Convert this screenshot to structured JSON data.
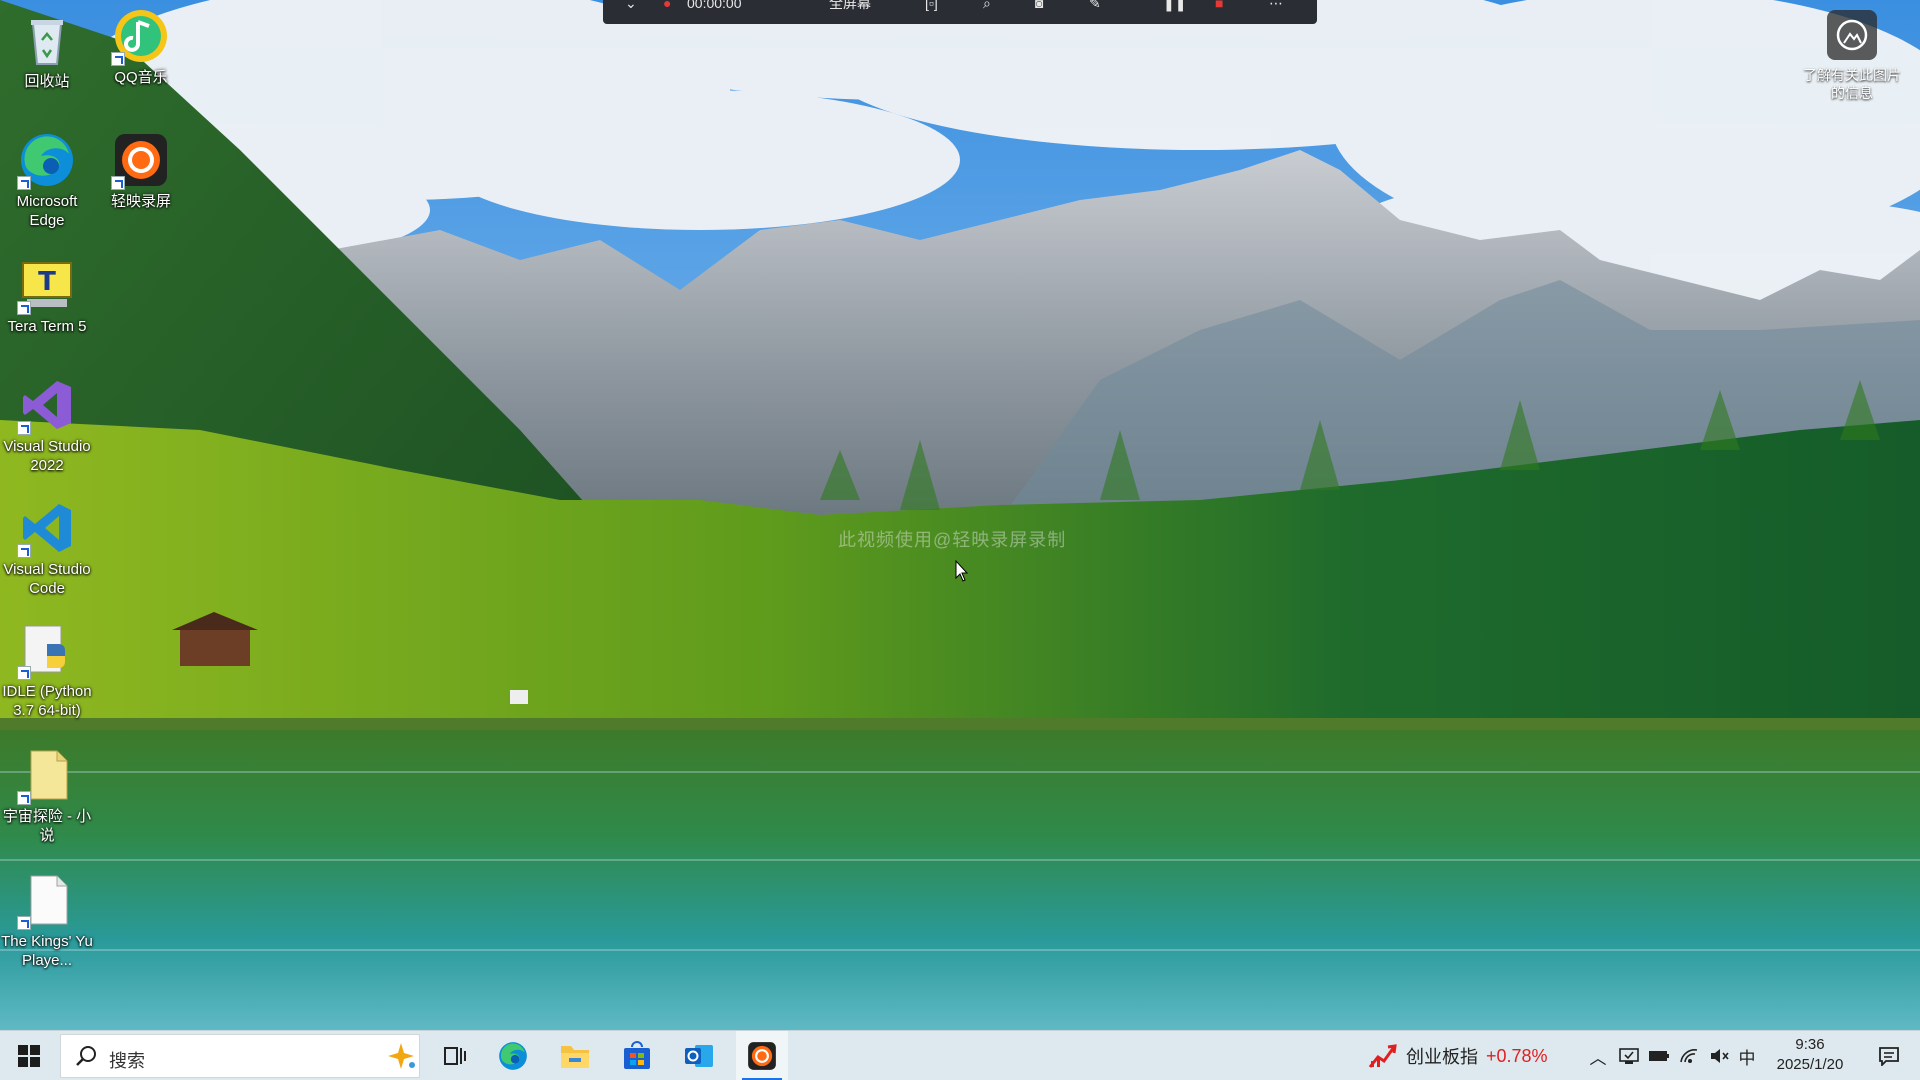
{
  "desktop_icons": [
    {
      "id": "recycle-bin",
      "label": "回收站"
    },
    {
      "id": "qq-music",
      "label": "QQ音乐"
    },
    {
      "id": "microsoft-edge",
      "label": "Microsoft Edge"
    },
    {
      "id": "qingying-recorder",
      "label": "轻映录屏"
    },
    {
      "id": "tera-term",
      "label": "Tera Term 5"
    },
    {
      "id": "visual-studio-2022",
      "label": "Visual Studio 2022"
    },
    {
      "id": "vscode",
      "label": "Visual Studio Code"
    },
    {
      "id": "idle-python",
      "label": "IDLE (Python 3.7 64-bit)"
    },
    {
      "id": "novel-doc",
      "label": "宇宙探险 - 小说"
    },
    {
      "id": "kings-doc",
      "label": "The Kings' Yu Playe..."
    }
  ],
  "spotlight": {
    "label": "了解有关此图片的信息"
  },
  "recorder_bar": {
    "time": "00:00:00",
    "quality": "全屏幕"
  },
  "watermark": "此视频使用@轻映录屏录制",
  "taskbar": {
    "search_placeholder": "搜索",
    "apps": [
      {
        "name": "task-view",
        "icon": "task-view-icon"
      },
      {
        "name": "edge",
        "icon": "edge-icon"
      },
      {
        "name": "file-explorer",
        "icon": "folder-icon"
      },
      {
        "name": "microsoft-store",
        "icon": "store-icon"
      },
      {
        "name": "outlook",
        "icon": "outlook-icon"
      },
      {
        "name": "qingying-recorder",
        "icon": "recorder-icon",
        "active": true
      }
    ],
    "stock": {
      "name": "创业板指",
      "change": "+0.78%",
      "change_color": "#e02020"
    },
    "tray": {
      "ime": "中",
      "time": "9:36",
      "date": "2025/1/20"
    }
  },
  "colors": {
    "taskbar_bg": "#dde9ee",
    "accent": "#1a73e8"
  }
}
